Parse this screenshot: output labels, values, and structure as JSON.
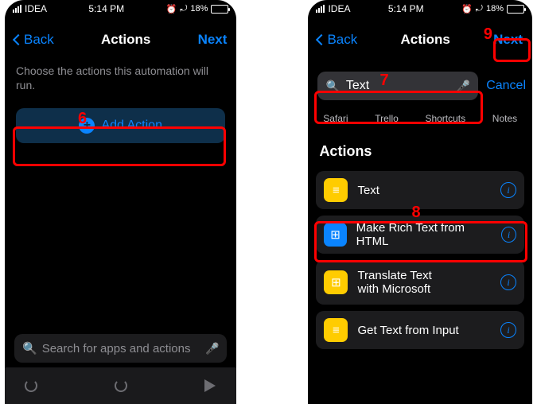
{
  "statusbar": {
    "carrier": "IDEA",
    "time": "5:14 PM",
    "battery_pct": "18%",
    "alarm_icon": "⏰",
    "rotation_icon": "⤾"
  },
  "nav": {
    "back": "Back",
    "title": "Actions",
    "next": "Next"
  },
  "left": {
    "description": "Choose the actions this automation will run.",
    "add_action": "Add Action",
    "search_placeholder": "Search for apps and actions"
  },
  "right": {
    "search_value": "Text",
    "cancel": "Cancel",
    "apps": {
      "safari": "Safari",
      "trello": "Trello",
      "shortcuts": "Shortcuts",
      "notes": "Notes"
    },
    "section": "Actions",
    "actions": {
      "text": "Text",
      "rich": "Make Rich Text from HTML",
      "translate_l1": "Translate Text",
      "translate_l2": "with Microsoft",
      "getinput": "Get Text from Input"
    }
  },
  "callouts": {
    "c6": "6",
    "c7": "7",
    "c8": "8",
    "c9": "9"
  }
}
